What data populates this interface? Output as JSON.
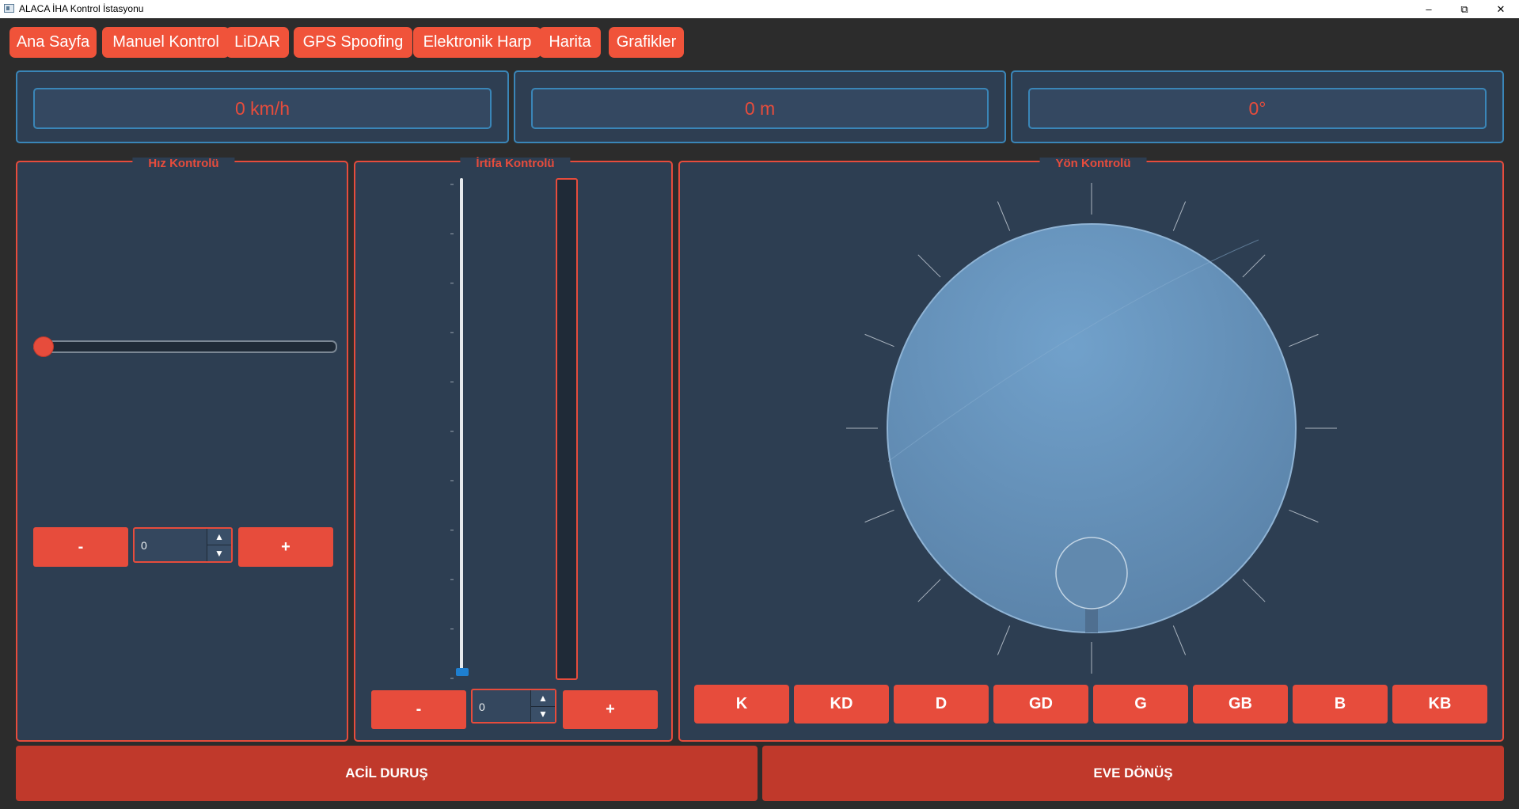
{
  "window": {
    "title": "ALACA İHA Kontrol İstasyonu",
    "controls": {
      "minimize": "–",
      "maximize": "⧉",
      "close": "✕"
    }
  },
  "tabs": [
    "Ana Sayfa",
    "Manuel Kontrol",
    "LiDAR",
    "GPS Spoofing",
    "Elektronik Harp",
    "Harita",
    "Grafikler"
  ],
  "readouts": {
    "speed": "0 km/h",
    "altitude": "0 m",
    "heading": "0°"
  },
  "speed_control": {
    "title": "Hız Kontrolü",
    "slider_fraction": 0,
    "minus": "-",
    "plus": "+",
    "value": "0"
  },
  "altitude_control": {
    "title": "İrtifa Kontrolü",
    "slider_fraction": 0,
    "bar_fraction": 0,
    "minus": "-",
    "plus": "+",
    "value": "0"
  },
  "heading_control": {
    "title": "Yön Kontrolü",
    "dial_value": 0,
    "directions": [
      "K",
      "KD",
      "D",
      "GD",
      "G",
      "GB",
      "B",
      "KB"
    ]
  },
  "actions": {
    "emergency_stop": "ACİL DURUŞ",
    "return_home": "EVE DÖNÜŞ"
  },
  "colors": {
    "accent": "#e74c3c",
    "panel": "#2d3e52",
    "info_border": "#3a86b8",
    "background": "#2c2c2c"
  }
}
